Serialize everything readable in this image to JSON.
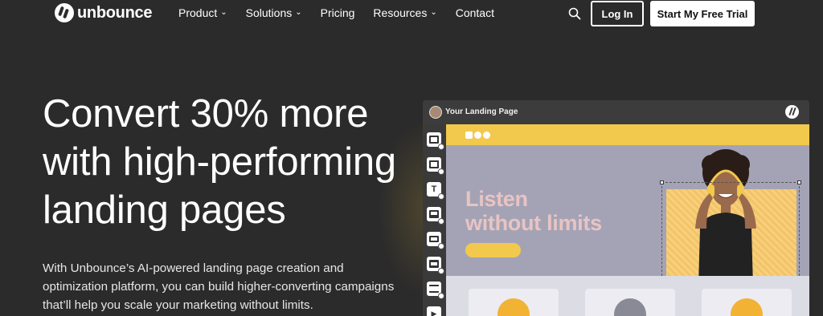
{
  "nav": {
    "logo_text": "unbounce",
    "items": [
      {
        "label": "Product",
        "dropdown": true
      },
      {
        "label": "Solutions",
        "dropdown": true
      },
      {
        "label": "Pricing",
        "dropdown": false
      },
      {
        "label": "Resources",
        "dropdown": true
      },
      {
        "label": "Contact",
        "dropdown": false
      }
    ],
    "search_icon": "search-icon",
    "login_label": "Log In",
    "trial_label": "Start My Free Trial"
  },
  "hero": {
    "title_lines": [
      "Convert 30% more",
      "with high-performing",
      "landing pages"
    ],
    "subtitle": "With Unbounce’s AI-powered landing page creation and optimization platform, you can build higher-converting campaigns that’ll help you scale your marketing without limits."
  },
  "mockup": {
    "window_title": "Your Landing Page",
    "headline_lines": [
      "Listen",
      "without limits"
    ],
    "tool_letters": [
      "",
      "",
      "T",
      "",
      "",
      "",
      "",
      ""
    ],
    "colors": {
      "accent_yellow": "#f2c94c",
      "hero_bg": "#a4a3b6",
      "headline": "#e8c4c2"
    }
  }
}
